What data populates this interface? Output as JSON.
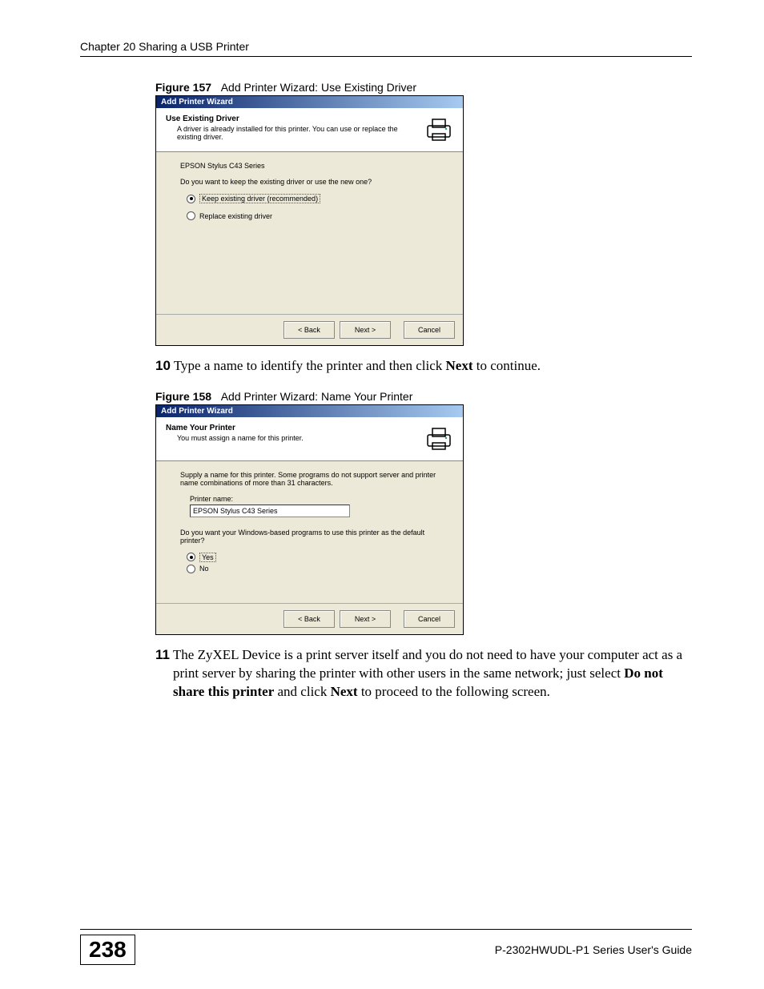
{
  "header": {
    "chapter": "Chapter 20 Sharing a USB Printer"
  },
  "figure157": {
    "label": "Figure 157",
    "caption": "Add Printer Wizard: Use Existing Driver",
    "titlebar": "Add Printer Wizard",
    "hdr_title": "Use Existing Driver",
    "hdr_sub": "A driver is already installed for this printer. You can use or replace the existing driver.",
    "printer_model": "EPSON Stylus C43 Series",
    "question": "Do you want to keep the existing driver or use the new one?",
    "radio_keep": "Keep existing driver (recommended)",
    "radio_replace": "Replace existing driver",
    "btn_back": "< Back",
    "btn_next": "Next >",
    "btn_cancel": "Cancel"
  },
  "step10": {
    "num": "10",
    "pre": " Type a name to identify the printer and then click ",
    "bold": "Next",
    "post": " to continue."
  },
  "figure158": {
    "label": "Figure 158",
    "caption": "Add Printer Wizard: Name Your Printer",
    "titlebar": "Add Printer Wizard",
    "hdr_title": "Name Your Printer",
    "hdr_sub": "You must assign a name for this printer.",
    "supply_text": "Supply a name for this printer. Some programs do not support server and printer name combinations of more than 31 characters.",
    "input_label": "Printer name:",
    "input_value": "EPSON Stylus C43 Series",
    "default_question": "Do you want your Windows-based programs to use this printer as the default printer?",
    "radio_yes": "Yes",
    "radio_no": "No",
    "btn_back": "< Back",
    "btn_next": "Next >",
    "btn_cancel": "Cancel"
  },
  "step11": {
    "num": "11",
    "pre": " The ZyXEL Device is a print server itself and you do not need to have your computer act as a print server by sharing the printer with other users in the same network; just select ",
    "bold1": "Do not share this printer",
    "mid": " and click ",
    "bold2": "Next",
    "post": " to proceed to the following screen."
  },
  "footer": {
    "page": "238",
    "guide": "P-2302HWUDL-P1 Series User's Guide"
  }
}
